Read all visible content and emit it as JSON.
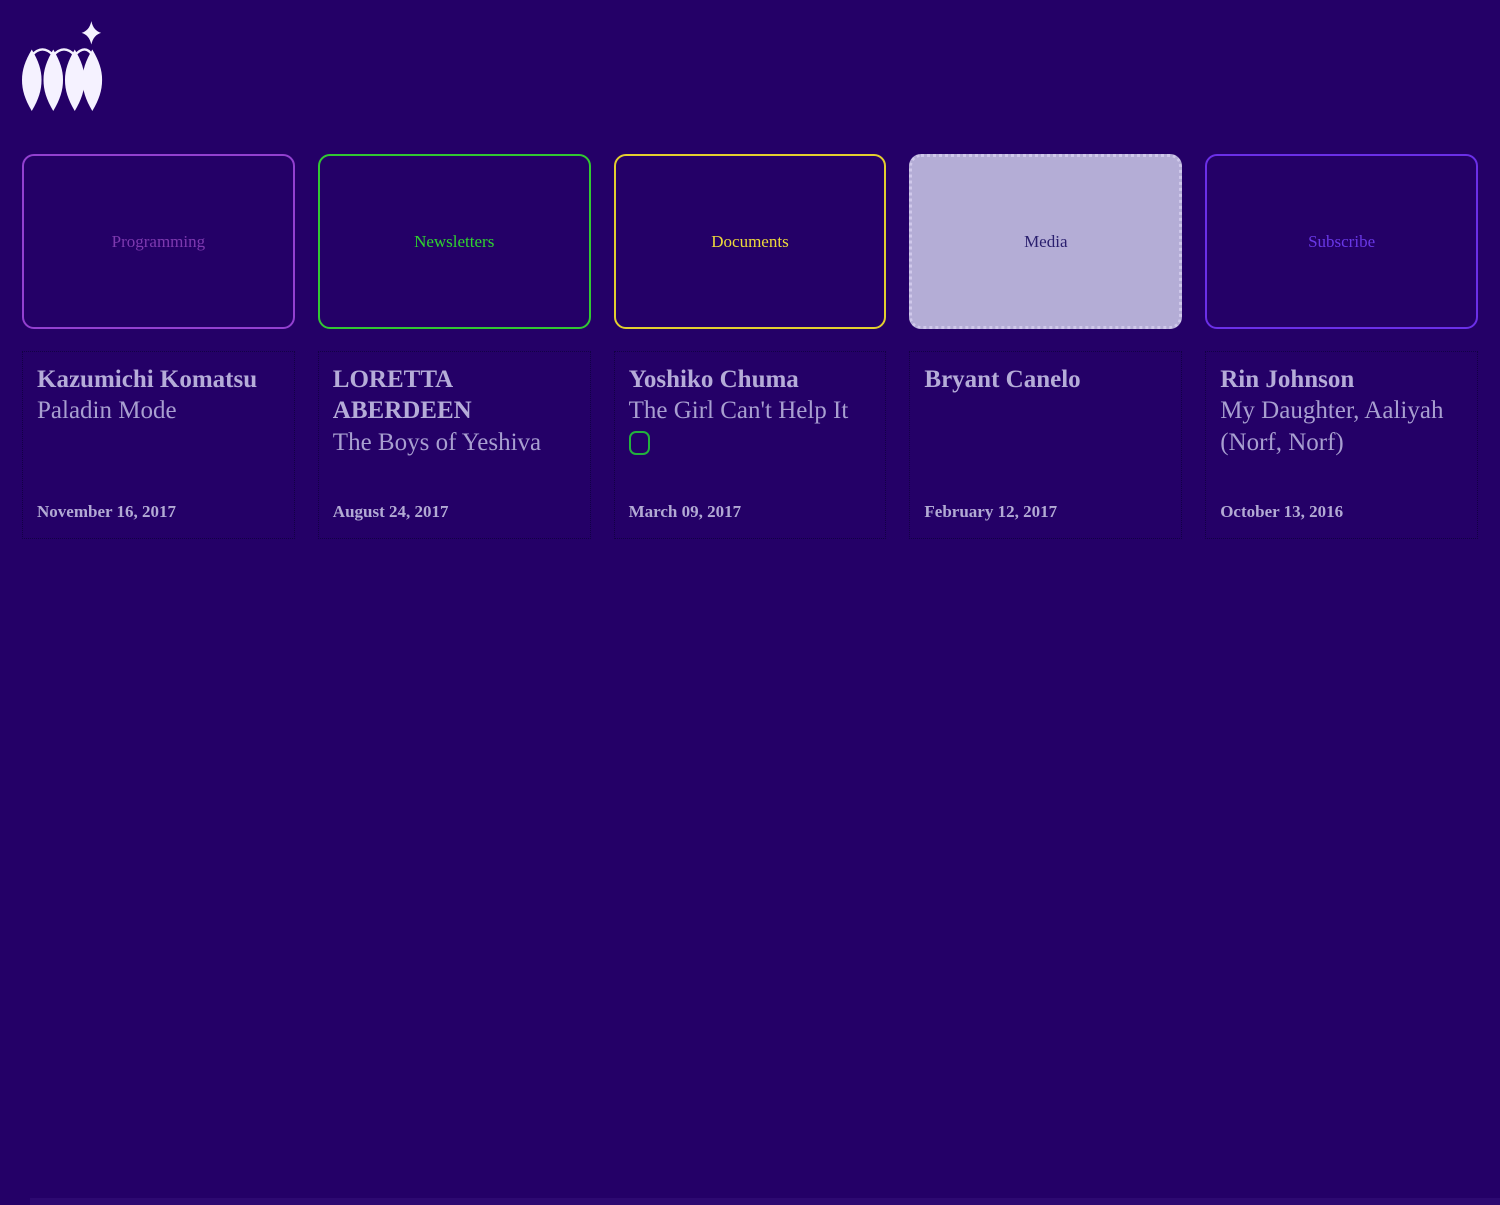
{
  "page": {
    "background_color": "#240067"
  },
  "logo": {
    "name": "mi-blackletter-logo",
    "color": "#F5F2FF"
  },
  "nav": {
    "items": [
      {
        "label": "Programming",
        "border_color": "#9340D0",
        "text_color": "#7E39B0",
        "fill_color": ""
      },
      {
        "label": "Newsletters",
        "border_color": "#32C832",
        "text_color": "#2FD32F",
        "fill_color": ""
      },
      {
        "label": "Documents",
        "border_color": "#E3CF2F",
        "text_color": "#EDD93B",
        "fill_color": ""
      },
      {
        "label": "Media",
        "border_color": "#CFC8EA",
        "text_color": "#2A1F6E",
        "fill_color": "#B4ADD6"
      },
      {
        "label": "Subscribe",
        "border_color": "#6B2FE8",
        "text_color": "#6937E6",
        "fill_color": ""
      }
    ]
  },
  "cards": [
    {
      "artist": "Kazumichi Komatsu",
      "title": "Paladin Mode",
      "date": "November 16, 2017"
    },
    {
      "artist": "LORETTA ABERDEEN",
      "title": "The Boys of Yeshiva",
      "date": "August 24, 2017"
    },
    {
      "artist": "Yoshiko Chuma",
      "title": "The Girl Can't Help It",
      "date": "March 09, 2017",
      "icon": "green-rounded-square-icon",
      "icon_color": "#22B23C"
    },
    {
      "artist": "Bryant Canelo",
      "title": "",
      "date": "February 12, 2017"
    },
    {
      "artist": "Rin Johnson",
      "title": "My Daughter, Aaliyah (Norf, Norf)",
      "date": "October 13, 2016"
    }
  ]
}
